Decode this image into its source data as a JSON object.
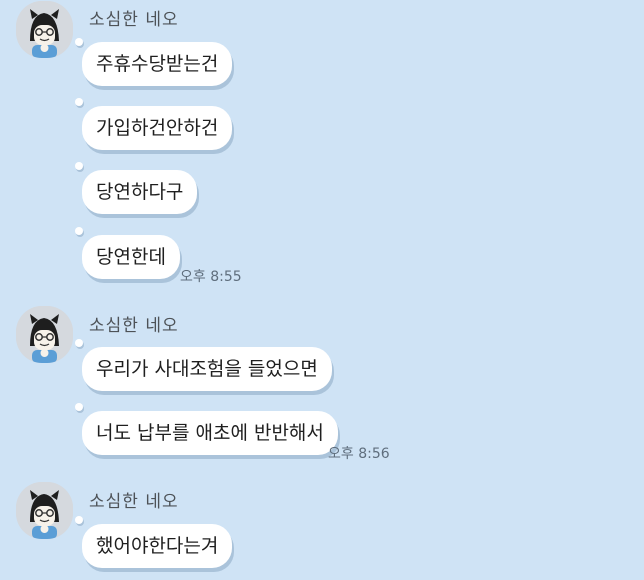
{
  "chat": {
    "groups": [
      {
        "sender": "소심한 네오",
        "messages": [
          {
            "text": "주휴수당받는건"
          },
          {
            "text": "가입하건안하건"
          },
          {
            "text": "당연하다구"
          },
          {
            "text": "당연한데",
            "time": "오후 8:55"
          }
        ]
      },
      {
        "sender": "소심한 네오",
        "messages": [
          {
            "text": "우리가 사대조험을 들었으면"
          },
          {
            "text": "너도 납부를 애초에 반반해서",
            "time": "오후 8:56"
          }
        ]
      },
      {
        "sender": "소심한 네오",
        "messages": [
          {
            "text": "했어야한다는겨"
          }
        ]
      }
    ]
  },
  "colors": {
    "background": "#cfe3f5",
    "bubble": "#ffffff",
    "avatar_bg": "#d5d9de"
  },
  "icons": {
    "avatar": "neo-cat-character-icon"
  }
}
